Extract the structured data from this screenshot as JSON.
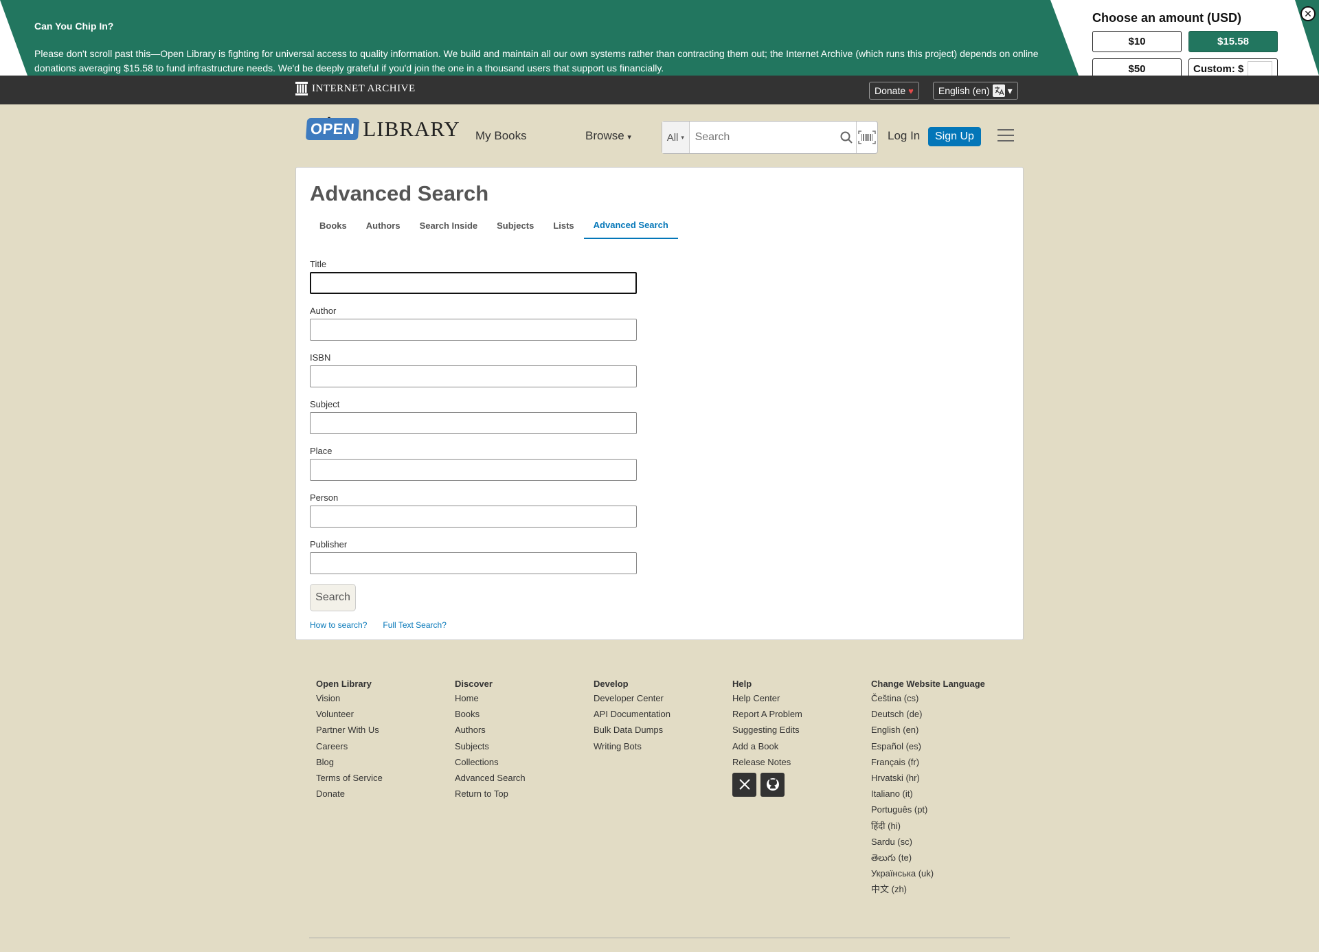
{
  "banner": {
    "title": "Can You Chip In?",
    "body": "Please don't scroll past this—Open Library is fighting for universal access to quality information. We build and maintain all our own systems rather than contracting them out; the Internet Archive (which runs this project) depends on online donations averaging $15.58 to fund infrastructure needs. We'd be deeply grateful if you'd join the one in a thousand users that support us financially.",
    "amount_title": "Choose an amount (USD)",
    "amounts": [
      "$10",
      "$15.58",
      "$50"
    ],
    "selected_amount": "$15.58",
    "custom_label": "Custom: $",
    "close_label": "✕",
    "accent_color": "#22765f"
  },
  "ia_bar": {
    "logo_text": "INTERNET ARCHIVE",
    "donate_label": "Donate",
    "heart": "♥",
    "language_label": "English (en)",
    "dropdown_arrow": "▾"
  },
  "header": {
    "logo_open": "OPEN",
    "logo_library": "LIBRARY",
    "my_books": "My Books",
    "browse": "Browse",
    "browse_caret": "▾",
    "search_filter": "All",
    "search_placeholder": "Search",
    "login": "Log In",
    "signup": "Sign Up",
    "brand_color": "#0376b8"
  },
  "main": {
    "title": "Advanced Search",
    "tabs": [
      {
        "label": "Books",
        "active": false
      },
      {
        "label": "Authors",
        "active": false
      },
      {
        "label": "Search Inside",
        "active": false
      },
      {
        "label": "Subjects",
        "active": false
      },
      {
        "label": "Lists",
        "active": false
      },
      {
        "label": "Advanced Search",
        "active": true
      }
    ],
    "fields": {
      "title": {
        "label": "Title",
        "value": ""
      },
      "author": {
        "label": "Author",
        "value": ""
      },
      "isbn": {
        "label": "ISBN",
        "value": ""
      },
      "subject": {
        "label": "Subject",
        "value": ""
      },
      "place": {
        "label": "Place",
        "value": ""
      },
      "person": {
        "label": "Person",
        "value": ""
      },
      "publisher": {
        "label": "Publisher",
        "value": ""
      }
    },
    "submit_label": "Search",
    "how_to_search": "How to search?",
    "full_text_search": "Full Text Search?"
  },
  "footer": {
    "open_library": {
      "heading": "Open Library",
      "links": [
        "Vision",
        "Volunteer",
        "Partner With Us",
        "Careers",
        "Blog",
        "Terms of Service",
        "Donate"
      ]
    },
    "discover": {
      "heading": "Discover",
      "links": [
        "Home",
        "Books",
        "Authors",
        "Subjects",
        "Collections",
        "Advanced Search",
        "Return to Top"
      ]
    },
    "develop": {
      "heading": "Develop",
      "links": [
        "Developer Center",
        "API Documentation",
        "Bulk Data Dumps",
        "Writing Bots"
      ]
    },
    "help": {
      "heading": "Help",
      "links": [
        "Help Center",
        "Report A Problem",
        "Suggesting Edits",
        "Add a Book",
        "Release Notes"
      ]
    },
    "languages": {
      "heading": "Change Website Language",
      "links": [
        "Čeština (cs)",
        "Deutsch (de)",
        "English (en)",
        "Español (es)",
        "Français (fr)",
        "Hrvatski (hr)",
        "Italiano (it)",
        "Português (pt)",
        "हिंदी (hi)",
        "Sardu (sc)",
        "తెలుగు (te)",
        "Українська (uk)",
        "中文 (zh)"
      ]
    },
    "social": [
      "x-icon",
      "github-icon"
    ]
  }
}
